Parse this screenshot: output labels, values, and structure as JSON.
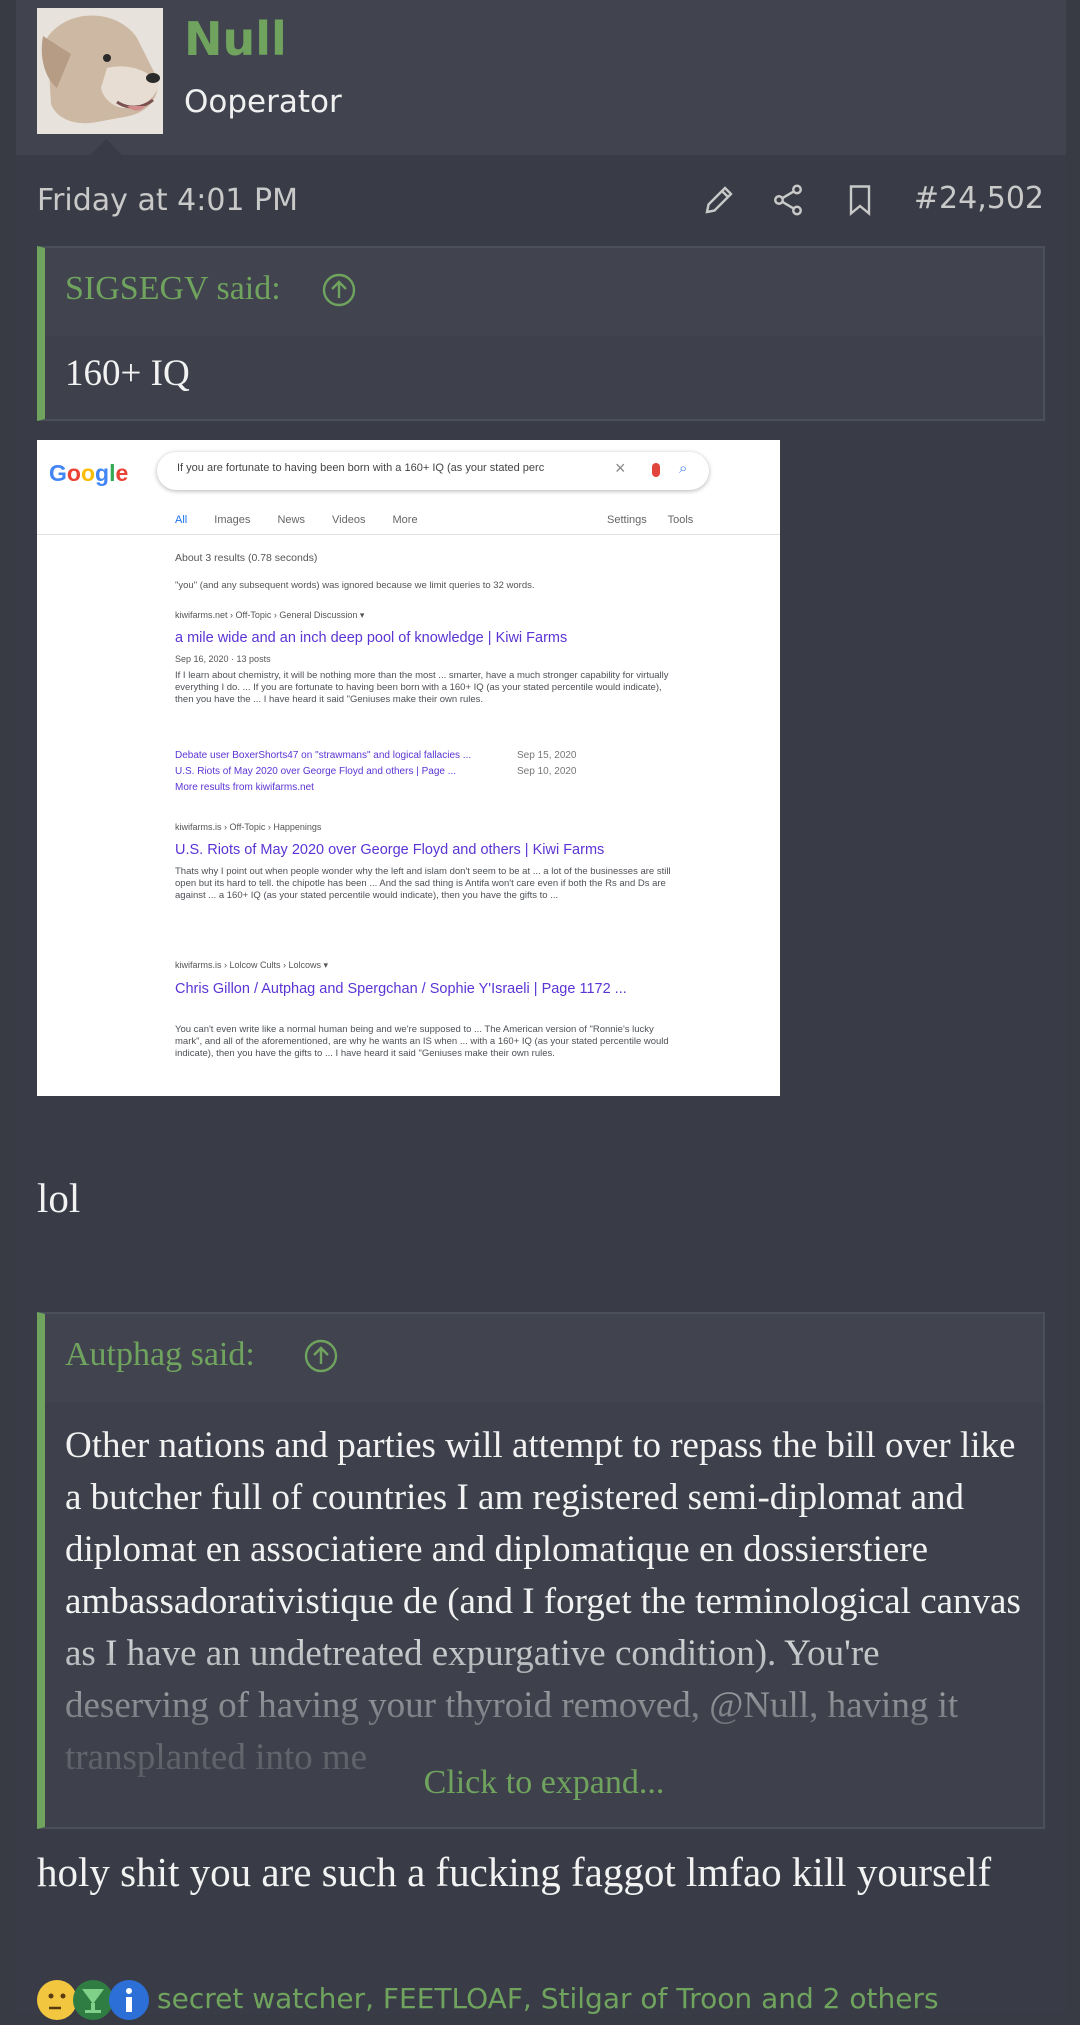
{
  "user": {
    "name": "Null",
    "title": "Ooperator"
  },
  "post": {
    "date": "Friday at 4:01 PM",
    "number": "#24,502",
    "icons": [
      "edit-icon",
      "share-icon",
      "bookmark-icon"
    ]
  },
  "quote1": {
    "author": "SIGSEGV said:",
    "body": "160+ IQ"
  },
  "screenshot": {
    "logo": "Google",
    "search_text": "If you are fortunate to having been born with a 160+ IQ (as your stated perc",
    "tabs": [
      "All",
      "Images",
      "News",
      "Videos",
      "More"
    ],
    "tabs_right": [
      "Settings",
      "Tools"
    ],
    "stats": "About 3 results (0.78 seconds)",
    "notice": "\"you\" (and any subsequent words) was ignored because we limit queries to 32 words.",
    "results": [
      {
        "breadcrumb": "kiwifarms.net › Off-Topic › General Discussion ▾",
        "title": "a mile wide and an inch deep pool of knowledge | Kiwi Farms",
        "date": "Sep 16, 2020 · 13 posts",
        "snippet": "If I learn about chemistry, it will be nothing more than the most ... smarter, have a much stronger capability for virtually everything I do. ... If you are fortunate to having been born with a 160+ IQ (as your stated percentile would indicate), then you have the ... I have heard it said \"Geniuses make their own rules.",
        "sitelinks": [
          {
            "text": "Debate user BoxerShorts47 on \"strawmans\" and logical fallacies ...",
            "date": "Sep 15, 2020"
          },
          {
            "text": "U.S. Riots of May 2020 over George Floyd and others | Page ...",
            "date": "Sep 10, 2020"
          },
          {
            "text": "More results from kiwifarms.net",
            "date": ""
          }
        ]
      },
      {
        "breadcrumb": "kiwifarms.is › Off-Topic › Happenings",
        "title": "U.S. Riots of May 2020 over George Floyd and others | Kiwi Farms",
        "snippet": "Thats why I point out when people wonder why the left and islam don't seem to be at ... a lot of the businesses are still open but its hard to tell. the chipotle has been ... And the sad thing is Antifa won't care even if both the Rs and Ds are against ... a 160+ IQ (as your stated percentile would indicate), then you have the gifts to ..."
      },
      {
        "breadcrumb": "kiwifarms.is › Lolcow Cults › Lolcows ▾",
        "title": "Chris Gillon / Autphag and Spergchan / Sophie Y'Israeli | Page 1172 ...",
        "snippet": "You can't even write like a normal human being and we're supposed to ... The American version of \"Ronnie's lucky mark\", and all of the aforementioned, are why he wants an IS when ... with a 160+ IQ (as your stated percentile would indicate), then you have the gifts to ... I have heard it said \"Geniuses make their own rules."
      }
    ]
  },
  "body_text": "lol",
  "quote2": {
    "author": "Autphag said:",
    "body": "Other nations and parties will attempt to repass the bill over like a butcher full of countries I am registered semi-diplomat and diplomat en associatiere and diplomatique en dossierstiere ambassadorativistique de (and I forget the terminological canvas as I have an undetreated expurgative condition). You're deserving of having your thyroid removed, @Null, having it transplanted into me",
    "expand_label": "Click to expand..."
  },
  "reply_text": "holy shit you are such a fucking faggot lmfao kill yourself",
  "reactions": {
    "emojis": [
      "thinking-emoji",
      "trophy-emoji",
      "informative-emoji"
    ],
    "names": "secret watcher, FEETLOAF, Stilgar of Troon and 2 others"
  },
  "colors": {
    "accent": "#6fa35e",
    "background": "#393c46",
    "header": "#41444f",
    "link_purple": "#5b34d4"
  }
}
